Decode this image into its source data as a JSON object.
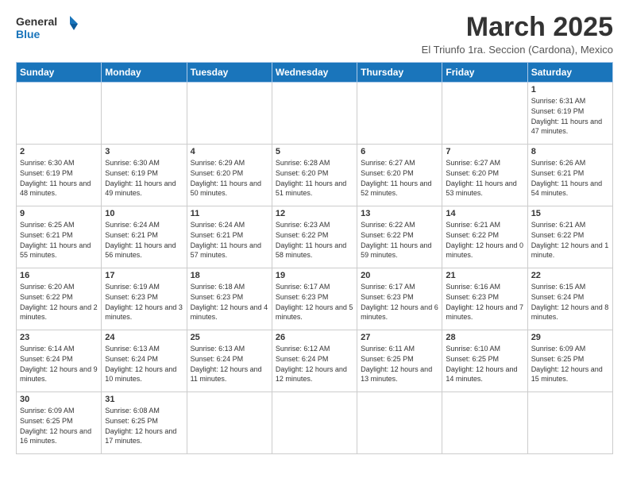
{
  "logo": {
    "text_general": "General",
    "text_blue": "Blue"
  },
  "header": {
    "month": "March 2025",
    "location": "El Triunfo 1ra. Seccion (Cardona), Mexico"
  },
  "weekdays": [
    "Sunday",
    "Monday",
    "Tuesday",
    "Wednesday",
    "Thursday",
    "Friday",
    "Saturday"
  ],
  "days": {
    "d1": {
      "num": "1",
      "sunrise": "6:31 AM",
      "sunset": "6:19 PM",
      "daylight": "11 hours and 47 minutes."
    },
    "d2": {
      "num": "2",
      "sunrise": "6:30 AM",
      "sunset": "6:19 PM",
      "daylight": "11 hours and 48 minutes."
    },
    "d3": {
      "num": "3",
      "sunrise": "6:30 AM",
      "sunset": "6:19 PM",
      "daylight": "11 hours and 49 minutes."
    },
    "d4": {
      "num": "4",
      "sunrise": "6:29 AM",
      "sunset": "6:20 PM",
      "daylight": "11 hours and 50 minutes."
    },
    "d5": {
      "num": "5",
      "sunrise": "6:28 AM",
      "sunset": "6:20 PM",
      "daylight": "11 hours and 51 minutes."
    },
    "d6": {
      "num": "6",
      "sunrise": "6:27 AM",
      "sunset": "6:20 PM",
      "daylight": "11 hours and 52 minutes."
    },
    "d7": {
      "num": "7",
      "sunrise": "6:27 AM",
      "sunset": "6:20 PM",
      "daylight": "11 hours and 53 minutes."
    },
    "d8": {
      "num": "8",
      "sunrise": "6:26 AM",
      "sunset": "6:21 PM",
      "daylight": "11 hours and 54 minutes."
    },
    "d9": {
      "num": "9",
      "sunrise": "6:25 AM",
      "sunset": "6:21 PM",
      "daylight": "11 hours and 55 minutes."
    },
    "d10": {
      "num": "10",
      "sunrise": "6:24 AM",
      "sunset": "6:21 PM",
      "daylight": "11 hours and 56 minutes."
    },
    "d11": {
      "num": "11",
      "sunrise": "6:24 AM",
      "sunset": "6:21 PM",
      "daylight": "11 hours and 57 minutes."
    },
    "d12": {
      "num": "12",
      "sunrise": "6:23 AM",
      "sunset": "6:22 PM",
      "daylight": "11 hours and 58 minutes."
    },
    "d13": {
      "num": "13",
      "sunrise": "6:22 AM",
      "sunset": "6:22 PM",
      "daylight": "11 hours and 59 minutes."
    },
    "d14": {
      "num": "14",
      "sunrise": "6:21 AM",
      "sunset": "6:22 PM",
      "daylight": "12 hours and 0 minutes."
    },
    "d15": {
      "num": "15",
      "sunrise": "6:21 AM",
      "sunset": "6:22 PM",
      "daylight": "12 hours and 1 minute."
    },
    "d16": {
      "num": "16",
      "sunrise": "6:20 AM",
      "sunset": "6:22 PM",
      "daylight": "12 hours and 2 minutes."
    },
    "d17": {
      "num": "17",
      "sunrise": "6:19 AM",
      "sunset": "6:23 PM",
      "daylight": "12 hours and 3 minutes."
    },
    "d18": {
      "num": "18",
      "sunrise": "6:18 AM",
      "sunset": "6:23 PM",
      "daylight": "12 hours and 4 minutes."
    },
    "d19": {
      "num": "19",
      "sunrise": "6:17 AM",
      "sunset": "6:23 PM",
      "daylight": "12 hours and 5 minutes."
    },
    "d20": {
      "num": "20",
      "sunrise": "6:17 AM",
      "sunset": "6:23 PM",
      "daylight": "12 hours and 6 minutes."
    },
    "d21": {
      "num": "21",
      "sunrise": "6:16 AM",
      "sunset": "6:23 PM",
      "daylight": "12 hours and 7 minutes."
    },
    "d22": {
      "num": "22",
      "sunrise": "6:15 AM",
      "sunset": "6:24 PM",
      "daylight": "12 hours and 8 minutes."
    },
    "d23": {
      "num": "23",
      "sunrise": "6:14 AM",
      "sunset": "6:24 PM",
      "daylight": "12 hours and 9 minutes."
    },
    "d24": {
      "num": "24",
      "sunrise": "6:13 AM",
      "sunset": "6:24 PM",
      "daylight": "12 hours and 10 minutes."
    },
    "d25": {
      "num": "25",
      "sunrise": "6:13 AM",
      "sunset": "6:24 PM",
      "daylight": "12 hours and 11 minutes."
    },
    "d26": {
      "num": "26",
      "sunrise": "6:12 AM",
      "sunset": "6:24 PM",
      "daylight": "12 hours and 12 minutes."
    },
    "d27": {
      "num": "27",
      "sunrise": "6:11 AM",
      "sunset": "6:25 PM",
      "daylight": "12 hours and 13 minutes."
    },
    "d28": {
      "num": "28",
      "sunrise": "6:10 AM",
      "sunset": "6:25 PM",
      "daylight": "12 hours and 14 minutes."
    },
    "d29": {
      "num": "29",
      "sunrise": "6:09 AM",
      "sunset": "6:25 PM",
      "daylight": "12 hours and 15 minutes."
    },
    "d30": {
      "num": "30",
      "sunrise": "6:09 AM",
      "sunset": "6:25 PM",
      "daylight": "12 hours and 16 minutes."
    },
    "d31": {
      "num": "31",
      "sunrise": "6:08 AM",
      "sunset": "6:25 PM",
      "daylight": "12 hours and 17 minutes."
    }
  }
}
